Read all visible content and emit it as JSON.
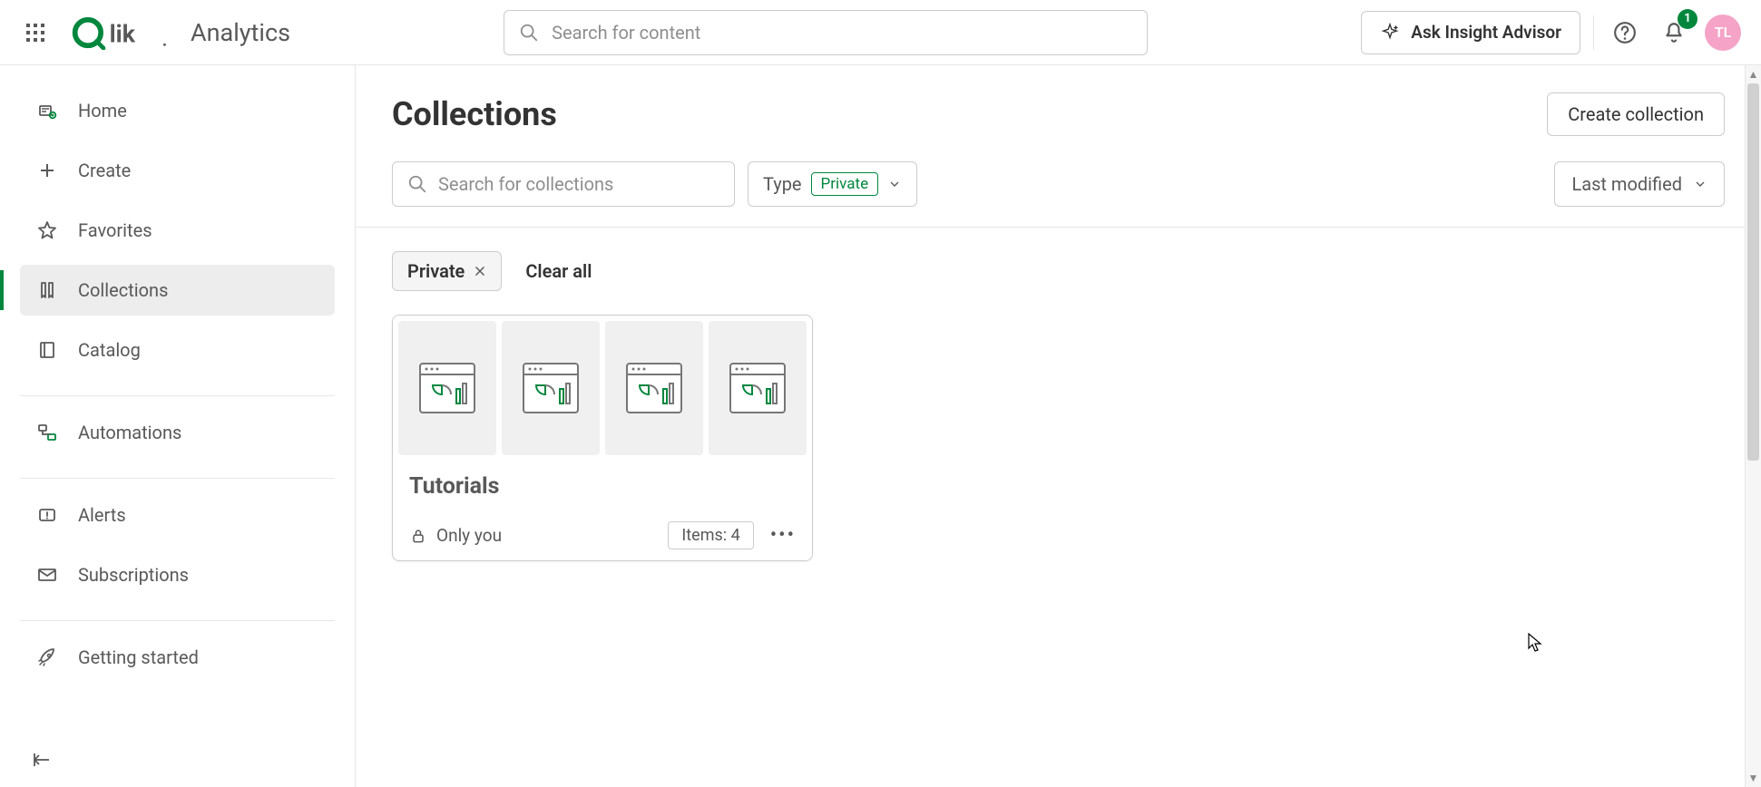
{
  "app_title": "Analytics",
  "search_placeholder": "Search for content",
  "ask_button": "Ask Insight Advisor",
  "notifications_count": "1",
  "avatar_initials": "TL",
  "sidebar": {
    "home": "Home",
    "create": "Create",
    "favorites": "Favorites",
    "collections": "Collections",
    "catalog": "Catalog",
    "automations": "Automations",
    "alerts": "Alerts",
    "subscriptions": "Subscriptions",
    "getting_started": "Getting started"
  },
  "page": {
    "title": "Collections",
    "create_button": "Create collection",
    "search_placeholder": "Search for collections",
    "type_label": "Type",
    "type_value": "Private",
    "sort_label": "Last modified",
    "filter_chip": "Private",
    "clear_all": "Clear all"
  },
  "card": {
    "title": "Tutorials",
    "visibility": "Only you",
    "items_label": "Items: 4"
  }
}
